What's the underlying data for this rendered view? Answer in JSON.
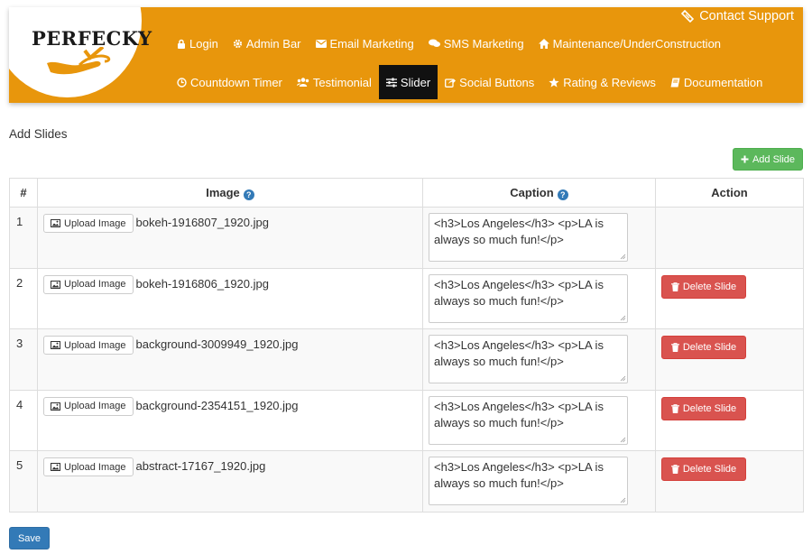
{
  "header": {
    "logo_text": "PERFECKY",
    "contact_label": "Contact Support",
    "nav_row1": [
      {
        "label": "Login",
        "icon": "lock-icon"
      },
      {
        "label": "Admin Bar",
        "icon": "gear-icon"
      },
      {
        "label": "Email Marketing",
        "icon": "envelope-icon"
      },
      {
        "label": "SMS Marketing",
        "icon": "comments-icon"
      },
      {
        "label": "Maintenance/UnderConstruction",
        "icon": "home-icon"
      }
    ],
    "nav_row2": [
      {
        "label": "Countdown Timer",
        "icon": "clock-icon"
      },
      {
        "label": "Testimonial",
        "icon": "users-icon"
      },
      {
        "label": "Slider",
        "icon": "sliders-icon",
        "active": true
      },
      {
        "label": "Social Buttons",
        "icon": "share-icon"
      },
      {
        "label": "Rating & Reviews",
        "icon": "star-icon"
      },
      {
        "label": "Documentation",
        "icon": "book-icon"
      }
    ]
  },
  "page": {
    "title": "Add Slides",
    "add_button": "Add Slide",
    "save_button": "Save"
  },
  "table": {
    "headers": {
      "num": "#",
      "image": "Image",
      "caption": "Caption",
      "action": "Action"
    },
    "upload_label": "Upload Image",
    "delete_label": "Delete Slide",
    "rows": [
      {
        "num": "1",
        "file": "bokeh-1916807_1920.jpg",
        "caption": "<h3>Los Angeles</h3> <p>LA is always so much fun!</p>",
        "deletable": false
      },
      {
        "num": "2",
        "file": "bokeh-1916806_1920.jpg",
        "caption": "<h3>Los Angeles</h3> <p>LA is always so much fun!</p>",
        "deletable": true
      },
      {
        "num": "3",
        "file": "background-3009949_1920.jpg",
        "caption": "<h3>Los Angeles</h3> <p>LA is always so much fun!</p>",
        "deletable": true
      },
      {
        "num": "4",
        "file": "background-2354151_1920.jpg",
        "caption": "<h3>Los Angeles</h3> <p>LA is always so much fun!</p>",
        "deletable": true
      },
      {
        "num": "5",
        "file": "abstract-17167_1920.jpg",
        "caption": "<h3>Los Angeles</h3> <p>LA is always so much fun!</p>",
        "deletable": true
      }
    ]
  },
  "colors": {
    "header_bg": "#e8960c",
    "nav_active_bg": "#111111",
    "add_button": "#5cb85c",
    "delete_button": "#d9534f",
    "save_button": "#337ab7"
  }
}
